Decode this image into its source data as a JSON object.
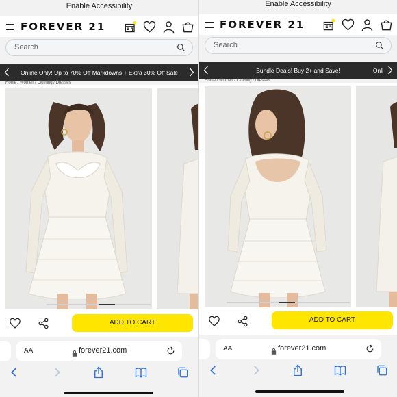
{
  "colors": {
    "accent": "#ffe600",
    "promo_bg": "#2b2b2b",
    "browser_blue": "#2a6fd6"
  },
  "left": {
    "accessibility_link": "Enable Accessibility",
    "brand": "FOREVER 21",
    "search_placeholder": "Search",
    "promo_text": "Online Only! Up to 70% Off Markdowns + Extra 30% Off Sale",
    "breadcrumb": "Home / Women / Clothing / Dresses",
    "add_to_cart": "ADD TO CART",
    "text_size": "AA",
    "url": "forever21.com",
    "image": "front-view-white-lace-mini-dress"
  },
  "right": {
    "accessibility_link": "Enable Accessibility",
    "brand": "FOREVER 21",
    "search_placeholder": "Search",
    "promo_text": "Bundle Deals! Buy 2+ and Save!",
    "promo_next": "Onli",
    "breadcrumb": "Home / Women / Clothing / Dresses",
    "add_to_cart": "ADD TO CART",
    "text_size": "AA",
    "url": "forever21.com",
    "image": "back-view-white-lace-mini-dress"
  },
  "icons": [
    "menu-icon",
    "store-icon",
    "heart-icon",
    "account-icon",
    "bag-icon",
    "search-icon",
    "chevron-left-icon",
    "chevron-right-icon",
    "share-icon",
    "lock-icon",
    "reload-icon",
    "back-icon",
    "forward-icon",
    "share-sheet-icon",
    "bookmarks-icon",
    "tabs-icon"
  ]
}
